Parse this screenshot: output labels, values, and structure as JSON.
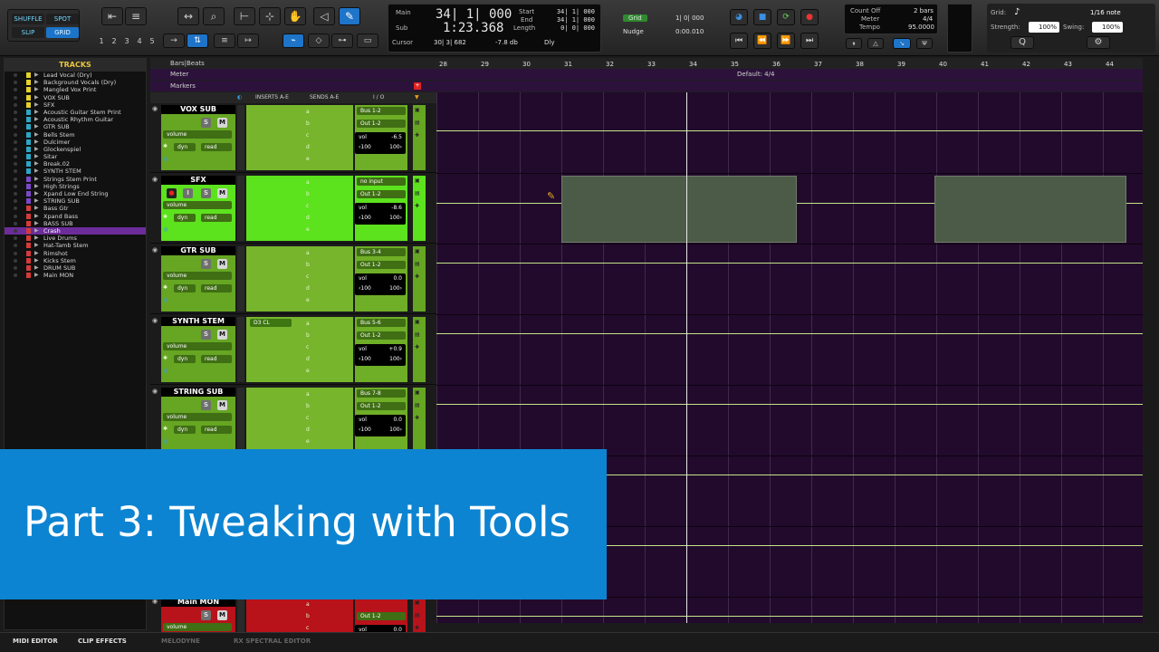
{
  "toolbar": {
    "modes": {
      "shuffle": "SHUFFLE",
      "spot": "SPOT",
      "slip": "SLIP",
      "grid": "GRID"
    },
    "zoom_presets": [
      "1",
      "2",
      "3",
      "4",
      "5"
    ],
    "counter": {
      "main_label": "Main",
      "main_value": "34| 1| 000",
      "sub_label": "Sub",
      "sub_value": "1:23.368",
      "start_label": "Start",
      "start_value": "34| 1| 000",
      "end_label": "End",
      "end_value": "34| 1| 000",
      "length_label": "Length",
      "length_value": "0| 0| 000",
      "cursor_label": "Cursor",
      "cursor_value": "30| 3| 682",
      "db_value": "-7.8 db",
      "dly_label": "Dly"
    },
    "grid": {
      "grid_label": "Grid",
      "grid_value": "1| 0| 000",
      "nudge_label": "Nudge",
      "nudge_value": "0:00.010"
    },
    "countoff": {
      "count_off": "Count Off",
      "count_val": "2 bars",
      "meter_label": "Meter",
      "meter_val": "4/4",
      "tempo_label": "Tempo",
      "tempo_val": "95.0000"
    },
    "quantize": {
      "grid_label": "Grid:",
      "grid_value": "1/16 note",
      "strength_label": "Strength:",
      "strength_value": "100%",
      "swing_label": "Swing:",
      "swing_value": "100%"
    }
  },
  "tracks_panel": {
    "title": "TRACKS",
    "items": [
      {
        "name": "Lead Vocal (Dry)",
        "color": "#e6d22c"
      },
      {
        "name": "Background Vocals (Dry)",
        "color": "#e6d22c"
      },
      {
        "name": "Mangled Vox Print",
        "color": "#e6d22c"
      },
      {
        "name": "VOX SUB",
        "color": "#e6d22c"
      },
      {
        "name": "SFX",
        "color": "#e6d22c"
      },
      {
        "name": "Acoustic Guitar Stem Print",
        "color": "#2aa7c4"
      },
      {
        "name": "Acoustic Rhythm Guitar",
        "color": "#2aa7c4"
      },
      {
        "name": "GTR SUB",
        "color": "#2aa7c4"
      },
      {
        "name": "Bells Stem",
        "color": "#2aa7c4"
      },
      {
        "name": "Dulcimer",
        "color": "#2aa7c4"
      },
      {
        "name": "Glockenspiel",
        "color": "#2aa7c4"
      },
      {
        "name": "Sitar",
        "color": "#2aa7c4"
      },
      {
        "name": "Break.02",
        "color": "#2aa7c4"
      },
      {
        "name": "SYNTH STEM",
        "color": "#2aa7c4"
      },
      {
        "name": "Strings Stem Print",
        "color": "#7b47c9"
      },
      {
        "name": "High Strings",
        "color": "#7b47c9"
      },
      {
        "name": "Xpand Low End String",
        "color": "#7b47c9"
      },
      {
        "name": "STRING SUB",
        "color": "#7b47c9"
      },
      {
        "name": "Bass Gtr",
        "color": "#d43a3a"
      },
      {
        "name": "Xpand Bass",
        "color": "#d43a3a"
      },
      {
        "name": "BASS SUB",
        "color": "#d43a3a"
      },
      {
        "name": "Crash",
        "color": "#d43a3a",
        "selected": true
      },
      {
        "name": "Live Drums",
        "color": "#d43a3a"
      },
      {
        "name": "Hat-Tamb Stem",
        "color": "#d43a3a"
      },
      {
        "name": "Rimshot",
        "color": "#d43a3a"
      },
      {
        "name": "Kicks Stem",
        "color": "#d43a3a"
      },
      {
        "name": "DRUM SUB",
        "color": "#d43a3a"
      },
      {
        "name": "Main MON",
        "color": "#d43a3a"
      }
    ]
  },
  "rulers": {
    "bars_beats": "Bars|Beats",
    "meter": "Meter",
    "markers": "Markers",
    "default_meter": "Default: 4/4"
  },
  "bar_numbers": [
    "28",
    "29",
    "30",
    "31",
    "32",
    "33",
    "34",
    "35",
    "36",
    "37",
    "38",
    "39",
    "40",
    "41",
    "42",
    "43",
    "44"
  ],
  "columns": {
    "inserts": "INSERTS A-E",
    "sends": "SENDS A-E",
    "io": "I / O"
  },
  "send_letters": [
    "a",
    "b",
    "c",
    "d",
    "e"
  ],
  "track_list": [
    {
      "name": "VOX SUB",
      "in": "Bus 1-2",
      "out": "Out 1-2",
      "vol": "-6.5",
      "pan_l": "‹100",
      "pan_r": "100›",
      "auto": "read",
      "mode": "volume",
      "dyn": "dyn"
    },
    {
      "name": "SFX",
      "in": "no input",
      "out": "Out 1-2",
      "vol": "-8.6",
      "pan_l": "‹100",
      "pan_r": "100›",
      "auto": "read",
      "mode": "volume",
      "dyn": "dyn"
    },
    {
      "name": "GTR SUB",
      "in": "Bus 3-4",
      "out": "Out 1-2",
      "vol": "0.0",
      "pan_l": "‹100",
      "pan_r": "100›",
      "auto": "read",
      "mode": "volume",
      "dyn": "dyn"
    },
    {
      "name": "SYNTH STEM",
      "in": "Bus 5-6",
      "out": "Out 1-2",
      "vol": "+0.9",
      "pan_l": "‹100",
      "pan_r": "100›",
      "auto": "read",
      "mode": "volume",
      "dyn": "dyn",
      "insert": "D3 CL"
    },
    {
      "name": "STRING SUB",
      "in": "Bus 7-8",
      "out": "Out 1-2",
      "vol": "0.0",
      "pan_l": "‹100",
      "pan_r": "100›",
      "auto": "read",
      "mode": "volume",
      "dyn": "dyn"
    },
    {
      "name": "Main MON",
      "out": "Out 1-2",
      "vol": "0.0",
      "mode": "volume"
    }
  ],
  "bottom_tabs": {
    "midi": "MIDI EDITOR",
    "clip": "CLIP EFFECTS",
    "melodyne": "MELODYNE",
    "rx": "RX SPECTRAL EDITOR"
  },
  "banner": {
    "title": "Part 3: Tweaking with Tools"
  }
}
